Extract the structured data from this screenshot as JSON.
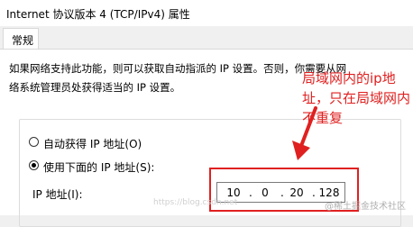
{
  "window": {
    "title": "Internet 协议版本 4 (TCP/IPv4) 属性"
  },
  "tabs": [
    {
      "label": "常规"
    }
  ],
  "description": {
    "line1": "如果网络支持此功能，则可以获取自动指派的 IP 设置。否则，你需要从网",
    "line2": "络系统管理员处获得适当的 IP 设置。"
  },
  "options": {
    "auto_ip": {
      "label": "自动获得 IP 地址(O)",
      "checked": false
    },
    "manual_ip": {
      "label": "使用下面的 IP 地址(S):",
      "checked": true
    }
  },
  "ip_address": {
    "label": "IP 地址(I):",
    "octets": [
      "10",
      "0",
      "20",
      "128"
    ]
  },
  "annotation": {
    "text": "局域网内的ip地址，只在局域网内不重复",
    "color": "#e02020"
  },
  "watermarks": {
    "main": "@稀土掘金技术社区",
    "faint": "https://blog.csdn.net"
  }
}
